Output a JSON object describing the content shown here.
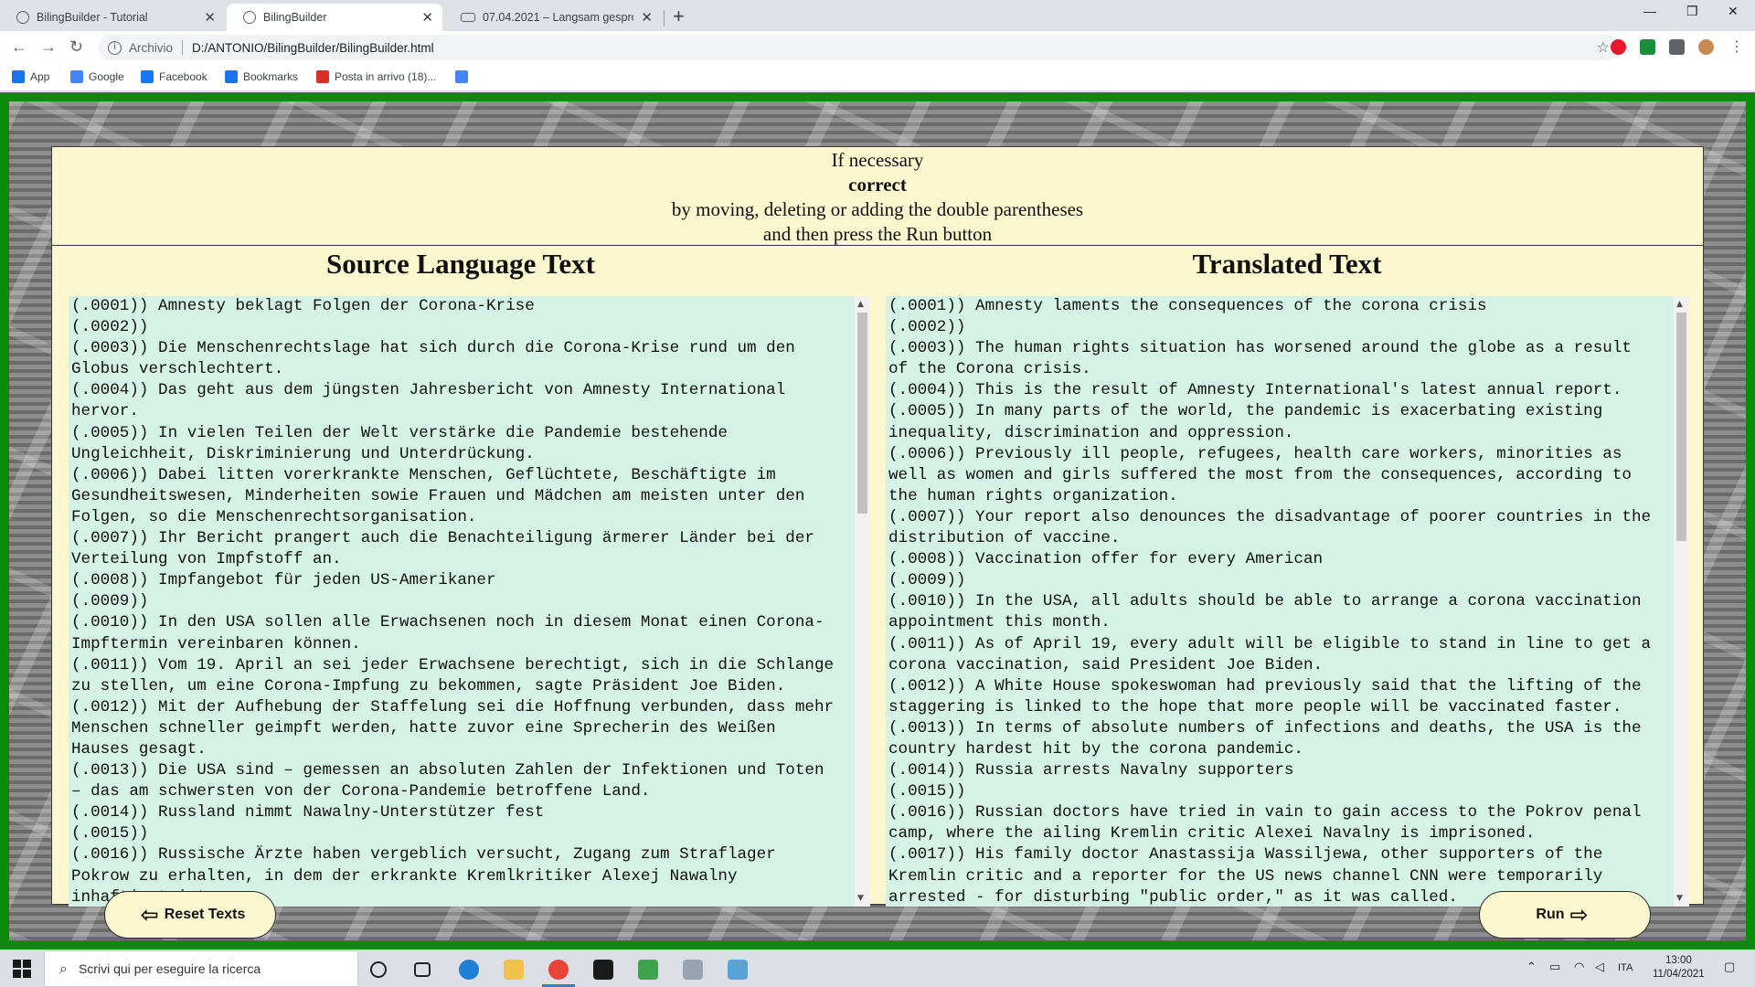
{
  "browser": {
    "tabs": [
      {
        "title": "BilingBuilder - Tutorial",
        "close": "✕"
      },
      {
        "title": "BilingBuilder",
        "close": "✕"
      },
      {
        "title": "07.04.2021 – Langsam gesproche",
        "close": "✕"
      }
    ],
    "new_tab": "+",
    "window_controls": {
      "minimize": "—",
      "restore": "❐",
      "close": "✕"
    },
    "nav": {
      "back": "←",
      "forward": "→",
      "reload": "↻"
    },
    "address": {
      "info": "i",
      "scheme": "Archivio",
      "url": "D:/ANTONIO/BilingBuilder/BilingBuilder.html",
      "star": "☆"
    },
    "bookmarks": [
      {
        "label": "App",
        "color": "#1a73e8"
      },
      {
        "label": "Google",
        "color": "#4285f4"
      },
      {
        "label": "Facebook",
        "color": "#1877f2"
      },
      {
        "label": "Bookmarks",
        "color": "#1a73e8"
      },
      {
        "label": "Posta in arrivo (18)...",
        "color": "#d93025"
      }
    ],
    "extension_colors": [
      "#e8192c",
      "#1e8e3e",
      "#5f6368",
      "#c58b51"
    ]
  },
  "page": {
    "instructions": {
      "line1": "If necessary",
      "line2": "correct",
      "line3": "by moving, deleting or adding the double parentheses",
      "line4": "and then press the Run button"
    },
    "source_title": "Source Language Text",
    "target_title": "Translated Text",
    "source_text": "(.0001)) Amnesty beklagt Folgen der Corona-Krise\n(.0002))\n(.0003)) Die Menschenrechtslage hat sich durch die Corona-Krise rund um den\nGlobus verschlechtert.\n(.0004)) Das geht aus dem jüngsten Jahresbericht von Amnesty International\nhervor.\n(.0005)) In vielen Teilen der Welt verstärke die Pandemie bestehende\nUngleichheit, Diskriminierung und Unterdrückung.\n(.0006)) Dabei litten vorerkrankte Menschen, Geflüchtete, Beschäftigte im\nGesundheitswesen, Minderheiten sowie Frauen und Mädchen am meisten unter den\nFolgen, so die Menschenrechtsorganisation.\n(.0007)) Ihr Bericht prangert auch die Benachteiligung ärmerer Länder bei der\nVerteilung von Impfstoff an.\n(.0008)) Impfangebot für jeden US-Amerikaner\n(.0009))\n(.0010)) In den USA sollen alle Erwachsenen noch in diesem Monat einen Corona-\nImpftermin vereinbaren können.\n(.0011)) Vom 19. April an sei jeder Erwachsene berechtigt, sich in die Schlange\nzu stellen, um eine Corona-Impfung zu bekommen, sagte Präsident Joe Biden.\n(.0012)) Mit der Aufhebung der Staffelung sei die Hoffnung verbunden, dass mehr\nMenschen schneller geimpft werden, hatte zuvor eine Sprecherin des Weißen\nHauses gesagt.\n(.0013)) Die USA sind – gemessen an absoluten Zahlen der Infektionen und Toten\n– das am schwersten von der Corona-Pandemie betroffene Land.\n(.0014)) Russland nimmt Nawalny-Unterstützer fest\n(.0015))\n(.0016)) Russische Ärzte haben vergeblich versucht, Zugang zum Straflager\nPokrow zu erhalten, in dem der erkrankte Kremlkritiker Alexej Nawalny\ninhaftiert ist.",
    "target_text": "(.0001)) Amnesty laments the consequences of the corona crisis\n(.0002))\n(.0003)) The human rights situation has worsened around the globe as a result\nof the Corona crisis.\n(.0004)) This is the result of Amnesty International's latest annual report.\n(.0005)) In many parts of the world, the pandemic is exacerbating existing\ninequality, discrimination and oppression.\n(.0006)) Previously ill people, refugees, health care workers, minorities as\nwell as women and girls suffered the most from the consequences, according to\nthe human rights organization.\n(.0007)) Your report also denounces the disadvantage of poorer countries in the\ndistribution of vaccine.\n(.0008)) Vaccination offer for every American\n(.0009))\n(.0010)) In the USA, all adults should be able to arrange a corona vaccination\nappointment this month.\n(.0011)) As of April 19, every adult will be eligible to stand in line to get a\ncorona vaccination, said President Joe Biden.\n(.0012)) A White House spokeswoman had previously said that the lifting of the\nstaggering is linked to the hope that more people will be vaccinated faster.\n(.0013)) In terms of absolute numbers of infections and deaths, the USA is the\ncountry hardest hit by the corona pandemic.\n(.0014)) Russia arrests Navalny supporters\n(.0015))\n(.0016)) Russian doctors have tried in vain to gain access to the Pokrov penal\ncamp, where the ailing Kremlin critic Alexei Navalny is imprisoned.\n(.0017)) His family doctor Anastassija Wassiljewa, other supporters of the\nKremlin critic and a reporter for the US news channel CNN were temporarily\narrested - for disturbing \"public order,\" as it was called.",
    "scroll_up": "▲",
    "scroll_down": "▼",
    "reset_button": {
      "label": "Reset Texts",
      "glyph": "⇦"
    },
    "run_button": {
      "label": "Run",
      "glyph": "⇨"
    }
  },
  "taskbar": {
    "search_placeholder": "Scrivi qui per eseguire la ricerca",
    "search_glyph": "⌕",
    "language": "ITA",
    "time": "13:00",
    "date": "11/04/2021"
  }
}
